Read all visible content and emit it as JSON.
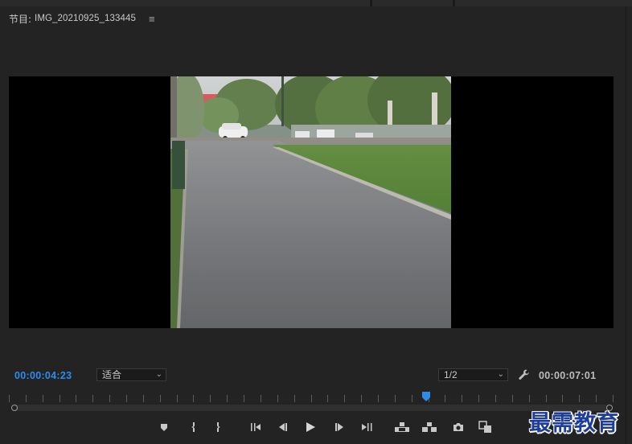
{
  "panel": {
    "title_prefix": "节目:",
    "sequence_name": "IMG_20210925_133445",
    "menu_icon": "hamburger-menu-icon"
  },
  "timecodes": {
    "current": "00:00:04:23",
    "duration": "00:00:07:01"
  },
  "fit_dropdown": {
    "value": "适合"
  },
  "resolution_dropdown": {
    "value": "1/2"
  },
  "playhead_fraction": 0.69,
  "colors": {
    "timecode_accent": "#2d8ceb",
    "panel_bg": "#232323",
    "watermark": "#1e3d9a"
  },
  "transport_buttons": [
    "add-marker-icon",
    "mark-in-icon",
    "mark-out-icon",
    "go-to-in-icon",
    "step-back-icon",
    "play-icon",
    "step-forward-icon",
    "go-to-out-icon",
    "lift-icon",
    "extract-icon",
    "export-frame-icon",
    "comparison-view-icon"
  ],
  "watermark": {
    "text": "最需教育"
  }
}
